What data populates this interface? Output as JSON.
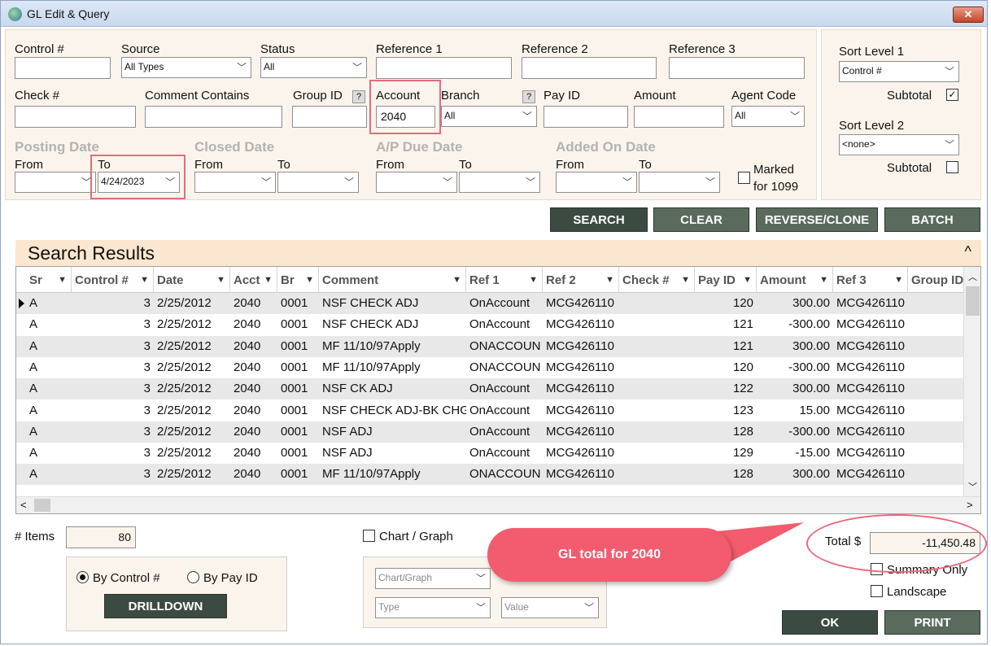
{
  "window": {
    "title": "GL Edit & Query",
    "close_label": "✕"
  },
  "filters": {
    "control_label": "Control #",
    "source_label": "Source",
    "source_value": "All Types",
    "status_label": "Status",
    "status_value": "All",
    "ref1_label": "Reference 1",
    "ref2_label": "Reference 2",
    "ref3_label": "Reference 3",
    "check_label": "Check #",
    "comment_label": "Comment Contains",
    "group_label": "Group ID",
    "account_label": "Account",
    "account_value": "2040",
    "branch_label": "Branch",
    "branch_value": "All",
    "payid_label": "Pay ID",
    "amount_label": "Amount",
    "agent_label": "Agent Code",
    "agent_value": "All",
    "help_glyph": "?",
    "posting_date": "Posting Date",
    "closed_date": "Closed Date",
    "ap_due_date": "A/P Due Date",
    "added_date": "Added On Date",
    "from_label": "From",
    "to_label": "To",
    "posting_to_value": "4/24/2023",
    "marked_line1": "Marked",
    "marked_line2": "for 1099"
  },
  "sort": {
    "level1_label": "Sort Level 1",
    "level1_value": "Control #",
    "subtotal_label": "Subtotal",
    "level2_label": "Sort Level 2",
    "level2_value": "<none>"
  },
  "buttons": {
    "search": "SEARCH",
    "clear": "CLEAR",
    "reverse": "REVERSE/CLONE",
    "batch": "BATCH",
    "drilldown": "DRILLDOWN",
    "ok": "OK",
    "print": "PRINT"
  },
  "results": {
    "title": "Search Results",
    "collapse_glyph": "^",
    "columns": [
      "Sr",
      "Control #",
      "Date",
      "Acct",
      "Br",
      "Comment",
      "Ref 1",
      "Ref 2",
      "Check #",
      "Pay ID",
      "Amount",
      "Ref 3",
      "Group ID"
    ],
    "rows": [
      [
        "A",
        "3",
        "2/25/2012",
        "2040",
        "0001",
        "NSF CHECK ADJ",
        "OnAccount",
        "MCG426110",
        "",
        "120",
        "300.00",
        "MCG426110",
        ""
      ],
      [
        "A",
        "3",
        "2/25/2012",
        "2040",
        "0001",
        "NSF CHECK ADJ",
        "OnAccount",
        "MCG426110",
        "",
        "121",
        "-300.00",
        "MCG426110",
        ""
      ],
      [
        "A",
        "3",
        "2/25/2012",
        "2040",
        "0001",
        "MF 11/10/97Apply",
        "ONACCOUN",
        "MCG426110",
        "",
        "121",
        "300.00",
        "MCG426110",
        ""
      ],
      [
        "A",
        "3",
        "2/25/2012",
        "2040",
        "0001",
        "MF 11/10/97Apply",
        "ONACCOUN",
        "MCG426110",
        "",
        "120",
        "-300.00",
        "MCG426110",
        ""
      ],
      [
        "A",
        "3",
        "2/25/2012",
        "2040",
        "0001",
        "NSF CK ADJ",
        "OnAccount",
        "MCG426110",
        "",
        "122",
        "300.00",
        "MCG426110",
        ""
      ],
      [
        "A",
        "3",
        "2/25/2012",
        "2040",
        "0001",
        "NSF CHECK ADJ-BK CHG",
        "OnAccount",
        "MCG426110",
        "",
        "123",
        "15.00",
        "MCG426110",
        ""
      ],
      [
        "A",
        "3",
        "2/25/2012",
        "2040",
        "0001",
        "NSF ADJ",
        "OnAccount",
        "MCG426110",
        "",
        "128",
        "-300.00",
        "MCG426110",
        ""
      ],
      [
        "A",
        "3",
        "2/25/2012",
        "2040",
        "0001",
        "NSF ADJ",
        "OnAccount",
        "MCG426110",
        "",
        "129",
        "-15.00",
        "MCG426110",
        ""
      ],
      [
        "A",
        "3",
        "2/25/2012",
        "2040",
        "0001",
        "MF 11/10/97Apply",
        "ONACCOUN",
        "MCG426110",
        "",
        "128",
        "300.00",
        "MCG426110",
        ""
      ]
    ]
  },
  "footer": {
    "items_label": "# Items",
    "items_value": "80",
    "chart_graph_label": "Chart / Graph",
    "by_control": "By Control #",
    "by_payid": "By Pay ID",
    "chart_combo": "Chart/Graph",
    "type_combo": "Type",
    "value_combo": "Value",
    "total_label": "Total $",
    "total_value": "-11,450.48",
    "summary_only": "Summary Only",
    "landscape": "Landscape"
  },
  "annotation": {
    "callout_text": "GL total for 2040"
  }
}
